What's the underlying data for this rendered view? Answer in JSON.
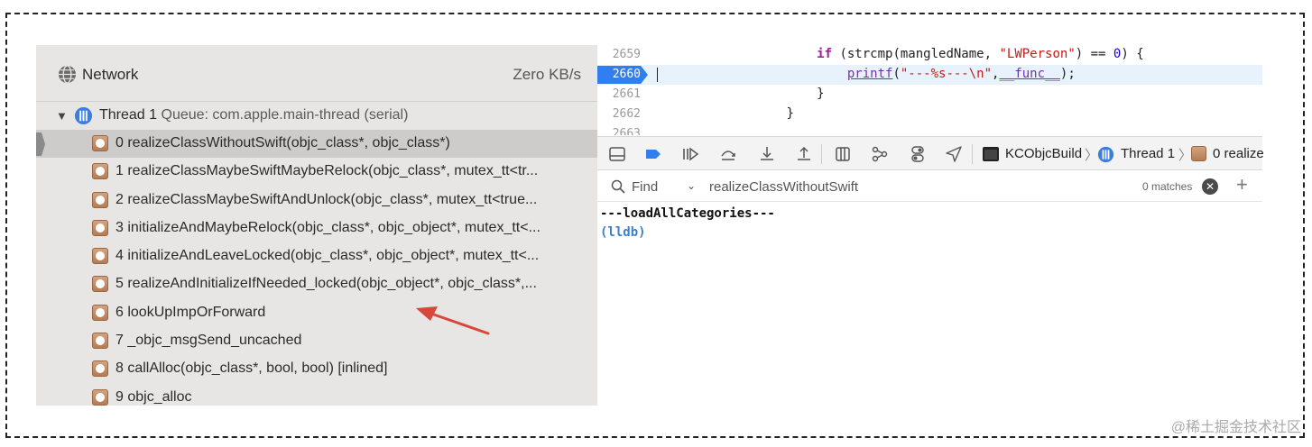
{
  "network": {
    "label": "Network",
    "value": "Zero KB/s"
  },
  "thread": {
    "name": "Thread 1",
    "queue": "Queue: com.apple.main-thread (serial)"
  },
  "frames": [
    "0 realizeClassWithoutSwift(objc_class*, objc_class*)",
    "1 realizeClassMaybeSwiftMaybeRelock(objc_class*, mutex_tt<tr...",
    "2 realizeClassMaybeSwiftAndUnlock(objc_class*, mutex_tt<true...",
    "3 initializeAndMaybeRelock(objc_class*, objc_object*, mutex_tt<...",
    "4 initializeAndLeaveLocked(objc_class*, objc_object*, mutex_tt<...",
    "5 realizeAndInitializeIfNeeded_locked(objc_object*, objc_class*,...",
    "6 lookUpImpOrForward",
    "7 _objc_msgSend_uncached",
    "8 callAlloc(objc_class*, bool, bool) [inlined]",
    "9 objc_alloc"
  ],
  "selected_frame_index": 0,
  "code": {
    "lines": [
      {
        "num": "2659",
        "parts": [
          [
            "kw",
            "if"
          ],
          [
            "ident",
            " ("
          ],
          [
            "fnc",
            "strcmp"
          ],
          [
            "ident",
            "(mangledName, "
          ],
          [
            "str",
            "\"LWPerson\""
          ],
          [
            "ident",
            ") == "
          ],
          [
            "num",
            "0"
          ],
          [
            "ident",
            ") {"
          ]
        ]
      },
      {
        "num": "2660",
        "current": true,
        "parts": [
          [
            "fn",
            "printf"
          ],
          [
            "ident",
            "("
          ],
          [
            "str",
            "\"---%s---\\n\""
          ],
          [
            "ident",
            ","
          ],
          [
            "fn",
            "__func__"
          ],
          [
            "ident",
            ");"
          ]
        ]
      },
      {
        "num": "2661",
        "parts": [
          [
            "ident",
            "}"
          ]
        ]
      },
      {
        "num": "2662",
        "parts": [
          [
            "ident",
            "}"
          ]
        ]
      },
      {
        "num": "2663",
        "parts": []
      }
    ],
    "indent": [
      "            ",
      "                ",
      "            ",
      "        ",
      ""
    ]
  },
  "breadcrumb": {
    "project": "KCObjcBuild",
    "thread": "Thread 1",
    "frame": "0 realize"
  },
  "find": {
    "label": "Find",
    "query": "realizeClassWithoutSwift",
    "matches": "0 matches"
  },
  "console": {
    "output": "---loadAllCategories---",
    "prompt": "(lldb)"
  },
  "watermark": "@稀土掘金技术社区",
  "colors": {
    "accent": "#2f7ff1",
    "annotation_arrow": "#d9473b"
  }
}
